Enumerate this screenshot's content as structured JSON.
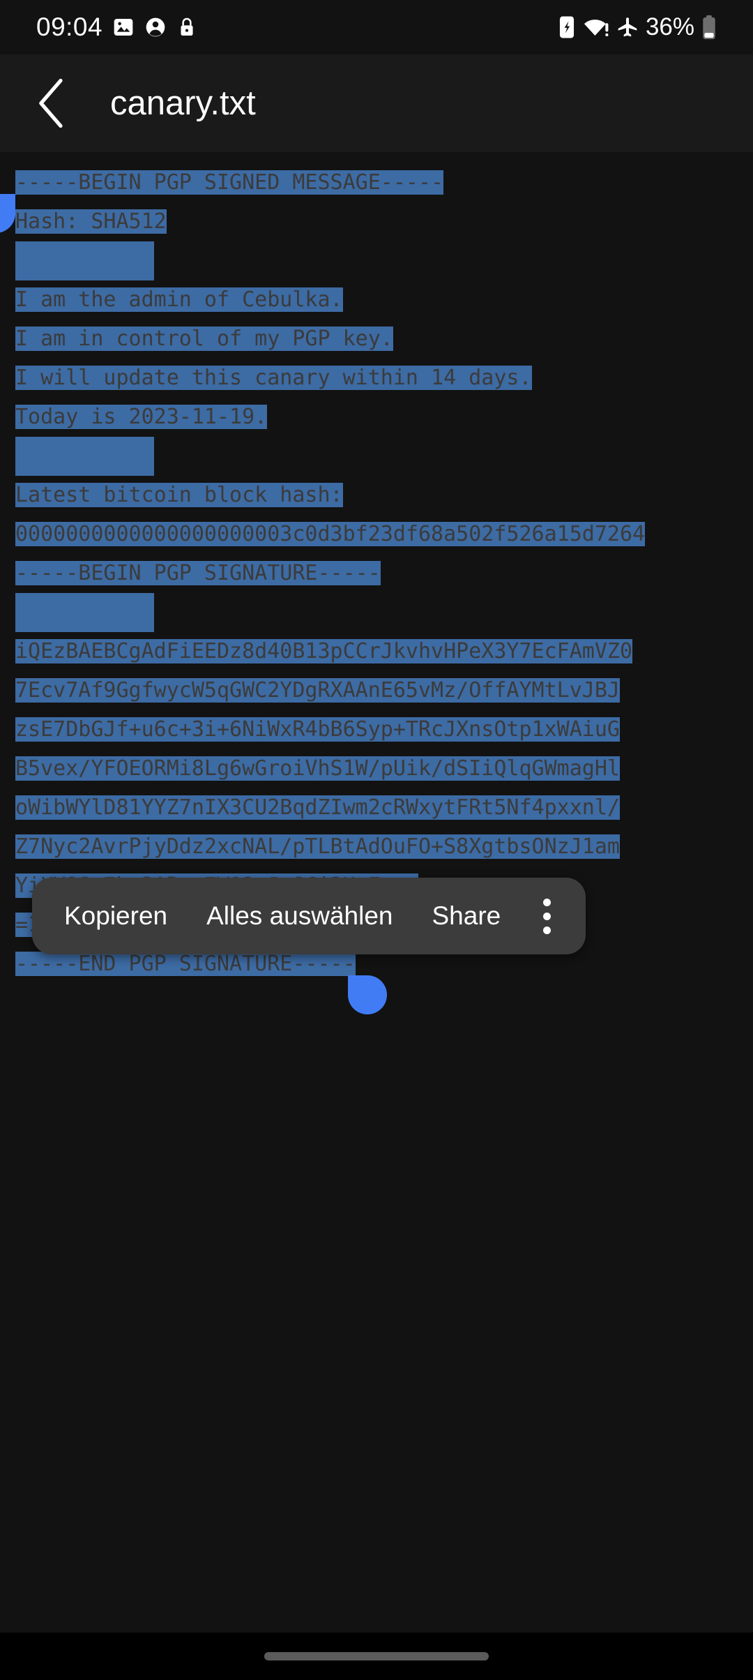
{
  "statusbar": {
    "time": "09:04",
    "battery_percent": "36%",
    "left_icons": [
      "image-icon",
      "account-circle-icon",
      "lock-icon"
    ],
    "right_icons": [
      "sim-card-icon",
      "wifi-alert-icon",
      "airplane-mode-icon",
      "battery-icon"
    ]
  },
  "appbar": {
    "back_icon": "chevron-left-icon",
    "title": "canary.txt"
  },
  "document": {
    "selection_color": "#3d6ba4",
    "handle_color": "#417cf5",
    "text_color": "#3a3a3a",
    "background": "#121212",
    "lines": [
      {
        "text": "-----BEGIN PGP SIGNED MESSAGE-----",
        "selected": true
      },
      {
        "text": "Hash: SHA512",
        "selected": true
      },
      {
        "text": "",
        "selected": true
      },
      {
        "text": "I am the admin of Cebulka.",
        "selected": true
      },
      {
        "text": "I am in control of my PGP key.",
        "selected": true
      },
      {
        "text": "I will update this canary within 14 days.",
        "selected": true
      },
      {
        "text": "Today is 2023-11-19.",
        "selected": true
      },
      {
        "text": "",
        "selected": true
      },
      {
        "text": "Latest bitcoin block hash:",
        "selected": true
      },
      {
        "text": "0000000000000000000003c0d3bf23df68a502f526a15d7264",
        "selected": true
      },
      {
        "text": "-----BEGIN PGP SIGNATURE-----",
        "selected": true
      },
      {
        "text": "",
        "selected": true
      },
      {
        "text": "iQEzBAEBCgAdFiEEDz8d40B13pCCrJkvhvHPeX3Y7EcFAmVZ0",
        "selected": true
      },
      {
        "text": "7Ecv7Af9GgfwycW5qGWC2YDgRXAAnE65vMz/OffAYMtLvJBJ",
        "selected": true
      },
      {
        "text": "zsE7DbGJf+u6c+3i+6NiWxR4bB6Syp+TRcJXnsOtp1xWAiuG",
        "selected": true
      },
      {
        "text": "B5vex/YFOEORMi8Lg6wGroiVhS1W/pUik/dSIiQlqGWmagHl",
        "selected": true
      },
      {
        "text": "oWibWYlD81YYZ7nIX3CU2BqdZIwm2cRWxytFRt5Nf4pxxnl/",
        "selected": true
      },
      {
        "text": "Z7Nyc2AvrPjyDdz2xcNAL/pTLBtAdOuFO+S8XgtbsONzJ1am",
        "selected": true
      },
      {
        "text": "YiXV9Sx7bg3ARzg7WO2uJq8Ci3HwFg==",
        "selected": true
      },
      {
        "text": "=1+M5",
        "selected": true
      },
      {
        "text": "-----END PGP SIGNATURE-----",
        "selected": true
      }
    ]
  },
  "context_menu": {
    "items": [
      {
        "label": "Kopieren",
        "name": "copy"
      },
      {
        "label": "Alles auswählen",
        "name": "select-all"
      },
      {
        "label": "Share",
        "name": "share"
      }
    ],
    "overflow_icon": "more-vertical-icon"
  },
  "navbar": {
    "gesture_pill": "home-gesture-pill"
  }
}
